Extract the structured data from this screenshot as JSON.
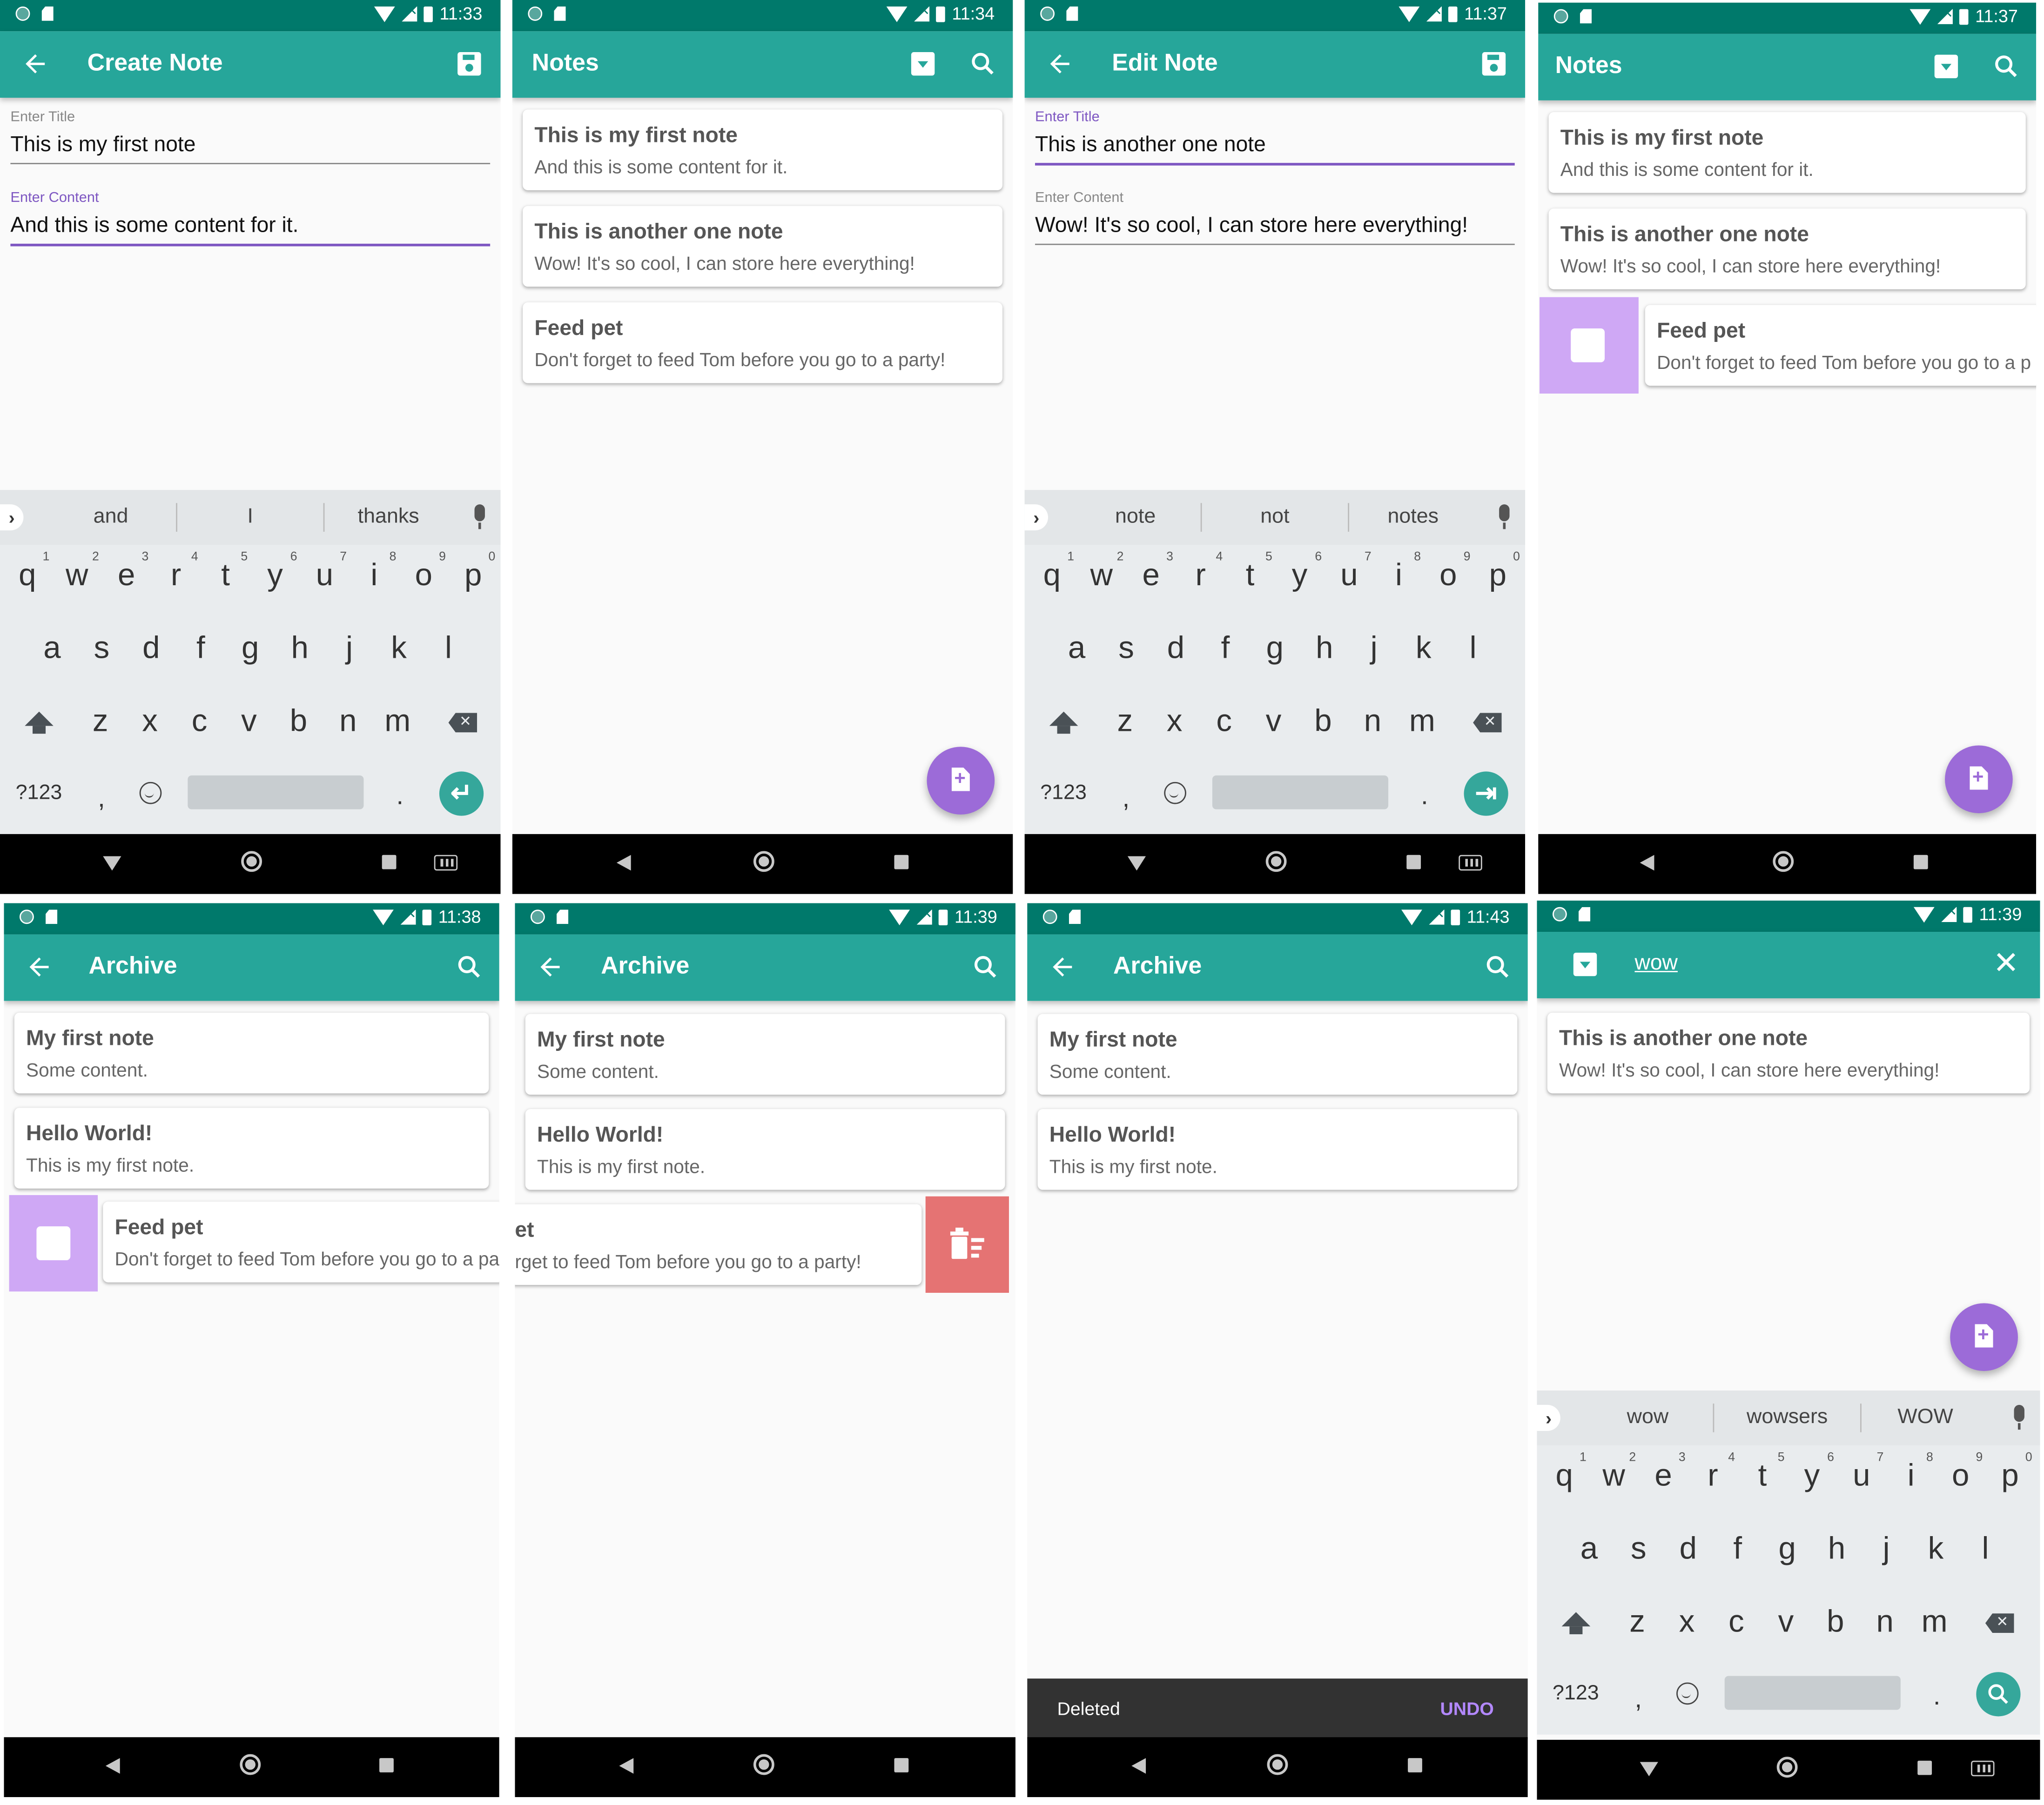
{
  "status": {
    "times": [
      "11:33",
      "11:34",
      "11:37",
      "11:37",
      "11:38",
      "11:39",
      "11:43",
      "11:39"
    ]
  },
  "colors": {
    "primary_dark": "#00796b",
    "primary": "#26a69a",
    "accent": "#9c6bd8",
    "swipe_archive": "#cfa8f5",
    "swipe_delete": "#e57373"
  },
  "screens": {
    "create": {
      "title": "Create Note",
      "title_label": "Enter Title",
      "title_value": "This is my first note",
      "content_label": "Enter Content",
      "content_value": "And this is some content for it.",
      "suggestions": [
        "and",
        "I",
        "thanks"
      ]
    },
    "notes": {
      "title": "Notes",
      "cards": [
        {
          "title": "This is my first note",
          "content": "And this is some content for it."
        },
        {
          "title": "This is another one note",
          "content": "Wow! It's so cool, I can store here everything!"
        },
        {
          "title": "Feed pet",
          "content": "Don't forget to feed Tom before you go to a party!"
        }
      ]
    },
    "edit": {
      "title": "Edit Note",
      "title_label": "Enter Title",
      "title_value": "This is another one note",
      "content_label": "Enter Content",
      "content_value": "Wow! It's so cool, I can store here everything!",
      "suggestions": [
        "note",
        "not",
        "notes"
      ]
    },
    "notes_swipe": {
      "title": "Notes",
      "cards": [
        {
          "title": "This is my first note",
          "content": "And this is some content for it."
        },
        {
          "title": "This is another one note",
          "content": "Wow! It's so cool, I can store here everything!"
        },
        {
          "title": "Feed pet",
          "content": "Don't forget to feed Tom before you go to a p"
        }
      ]
    },
    "archive1": {
      "title": "Archive",
      "cards": [
        {
          "title": "My first note",
          "content": "Some content."
        },
        {
          "title": "Hello World!",
          "content": "This is my first note."
        },
        {
          "title": "Feed pet",
          "content": "Don't forget to feed Tom before you go to a pa"
        }
      ]
    },
    "archive2": {
      "title": "Archive",
      "cards": [
        {
          "title": "My first note",
          "content": "Some content."
        },
        {
          "title": "Hello World!",
          "content": "This is my first note."
        },
        {
          "title": "et",
          "content": "rget to feed Tom before you go to a party!"
        }
      ]
    },
    "archive3": {
      "title": "Archive",
      "cards": [
        {
          "title": "My first note",
          "content": "Some content."
        },
        {
          "title": "Hello World!",
          "content": "This is my first note."
        }
      ],
      "snackbar_text": "Deleted",
      "snackbar_action": "UNDO"
    },
    "search": {
      "query": "wow",
      "cards": [
        {
          "title": "This is another one note",
          "content": "Wow! It's so cool, I can store here everything!"
        }
      ],
      "suggestions": [
        "wow",
        "wowsers",
        "WOW"
      ]
    }
  },
  "keyboard": {
    "row1": [
      "q",
      "w",
      "e",
      "r",
      "t",
      "y",
      "u",
      "i",
      "o",
      "p"
    ],
    "row1_nums": [
      "1",
      "2",
      "3",
      "4",
      "5",
      "6",
      "7",
      "8",
      "9",
      "0"
    ],
    "row2": [
      "a",
      "s",
      "d",
      "f",
      "g",
      "h",
      "j",
      "k",
      "l"
    ],
    "row3": [
      "z",
      "x",
      "c",
      "v",
      "b",
      "n",
      "m"
    ],
    "symbols_label": "?123",
    "comma": ",",
    "period": "."
  }
}
